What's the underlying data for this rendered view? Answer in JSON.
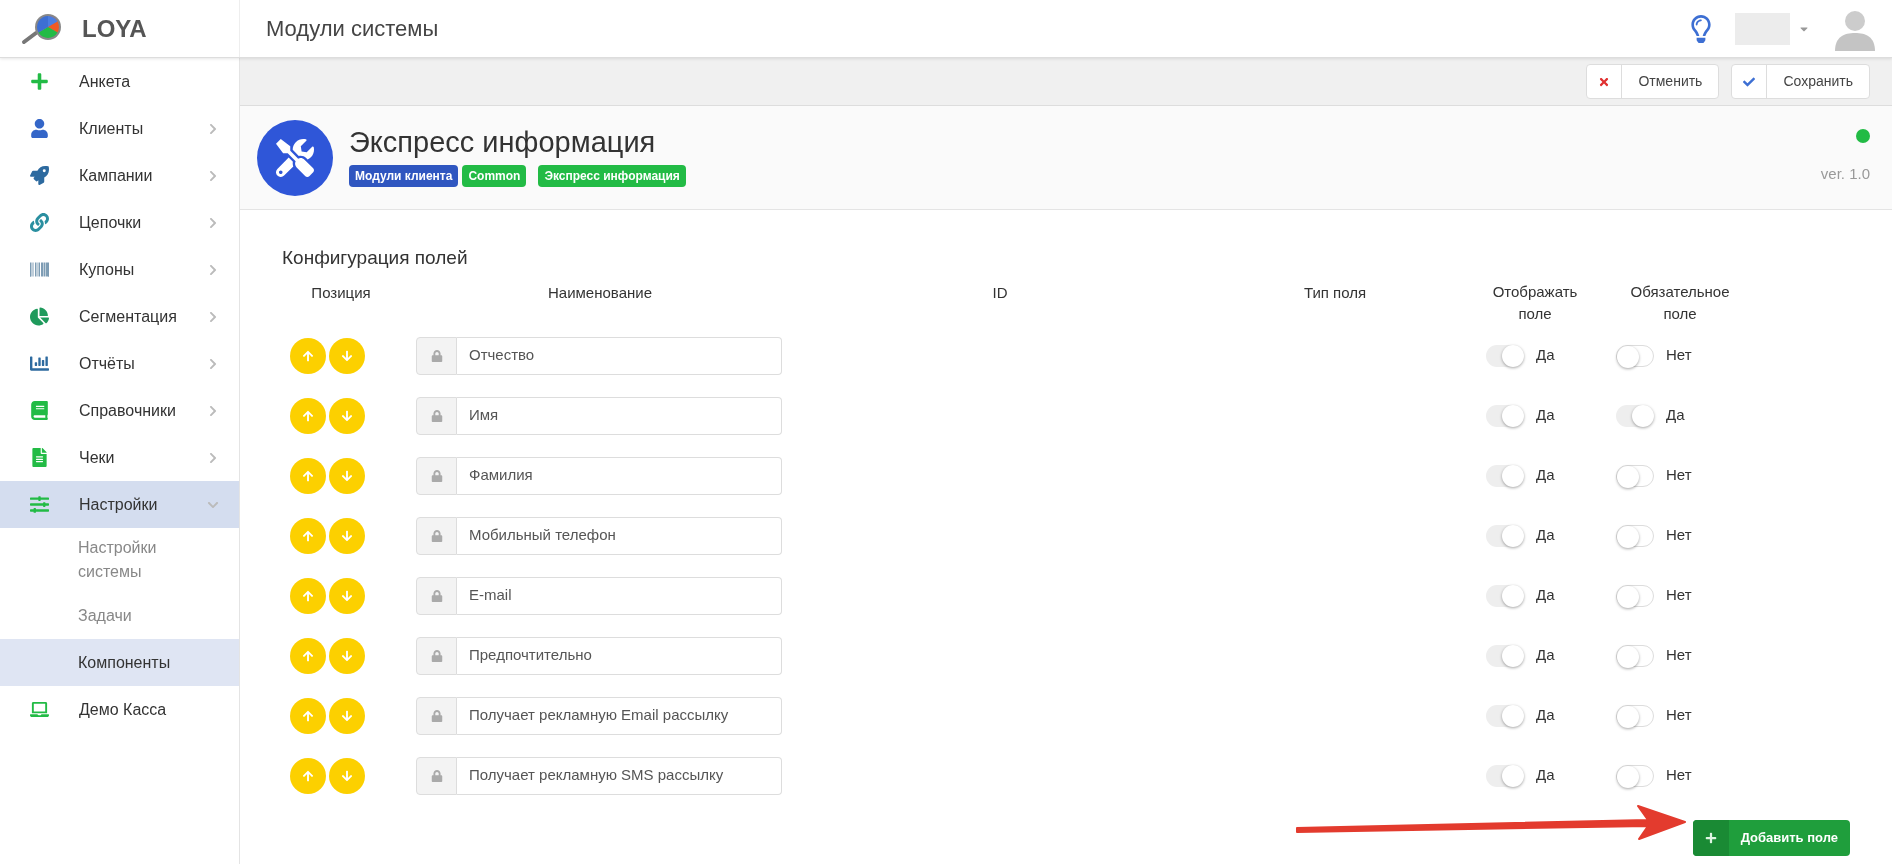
{
  "brand": "LOYA",
  "page_title": "Модули системы",
  "sidebar": {
    "items": [
      {
        "label": "Анкета",
        "selected": false
      },
      {
        "label": "Клиенты",
        "expanded": false,
        "selected": false
      },
      {
        "label": "Кампании",
        "expanded": false,
        "selected": false
      },
      {
        "label": "Цепочки",
        "expanded": false,
        "selected": false
      },
      {
        "label": "Купоны",
        "expanded": false,
        "selected": false
      },
      {
        "label": "Сегментация",
        "expanded": false,
        "selected": false
      },
      {
        "label": "Отчёты",
        "expanded": false,
        "selected": false
      },
      {
        "label": "Справочники",
        "expanded": false,
        "selected": false
      },
      {
        "label": "Чеки",
        "expanded": false,
        "selected": false
      },
      {
        "label": "Настройки",
        "expanded": true,
        "selected": true,
        "children": [
          {
            "label": "Настройки системы",
            "selected": false
          },
          {
            "label": "Задачи",
            "selected": false
          },
          {
            "label": "Компоненты",
            "selected": true
          }
        ]
      },
      {
        "label": "Демо Касса",
        "selected": false
      }
    ]
  },
  "toolbar": {
    "buttons": [
      {
        "kind": "cancel",
        "label": "Отменить"
      },
      {
        "kind": "save",
        "label": "Сохранить"
      }
    ]
  },
  "module": {
    "title": "Экспресс информация",
    "tags": [
      {
        "label": "Модули клиента",
        "color": "#2f56c0"
      },
      {
        "label": "Common",
        "color": "#22bb45"
      },
      {
        "label": "Экспресс информация",
        "color": "#22bb45"
      }
    ],
    "active": true,
    "version": "ver. 1.0"
  },
  "section_title": "Конфигурация полей",
  "table": {
    "columns": [
      "Позиция",
      "Наименование",
      "ID",
      "Тип поля",
      "Отображать поле",
      "Обязательное поле"
    ],
    "rows": [
      {
        "name": "Отчество",
        "visible": {
          "on": true,
          "label": "Да"
        },
        "required": {
          "on": false,
          "label": "Нет"
        }
      },
      {
        "name": "Имя",
        "visible": {
          "on": true,
          "label": "Да"
        },
        "required": {
          "on": true,
          "label": "Да"
        }
      },
      {
        "name": "Фамилия",
        "visible": {
          "on": true,
          "label": "Да"
        },
        "required": {
          "on": false,
          "label": "Нет"
        }
      },
      {
        "name": "Мобильный телефон",
        "visible": {
          "on": true,
          "label": "Да"
        },
        "required": {
          "on": false,
          "label": "Нет"
        }
      },
      {
        "name": "E-mail",
        "visible": {
          "on": true,
          "label": "Да"
        },
        "required": {
          "on": false,
          "label": "Нет"
        }
      },
      {
        "name": "Предпочтительно",
        "visible": {
          "on": true,
          "label": "Да"
        },
        "required": {
          "on": false,
          "label": "Нет"
        }
      },
      {
        "name": "Получает рекламную Email рассылку",
        "visible": {
          "on": true,
          "label": "Да"
        },
        "required": {
          "on": false,
          "label": "Нет"
        }
      },
      {
        "name": "Получает рекламную SMS рассылку",
        "visible": {
          "on": true,
          "label": "Да"
        },
        "required": {
          "on": false,
          "label": "Нет"
        }
      }
    ]
  },
  "add_button": {
    "label": "Добавить поле"
  }
}
